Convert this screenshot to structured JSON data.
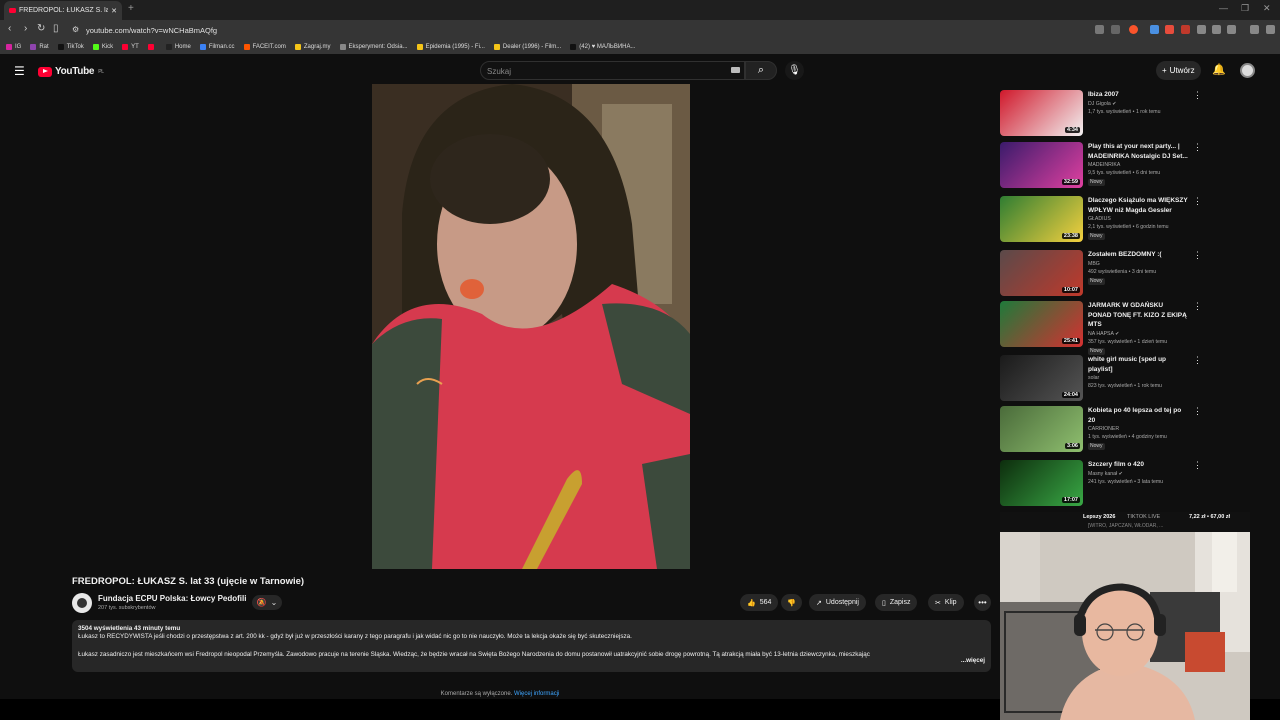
{
  "browser": {
    "tab_title": "FREDROPOL: ŁUKASZ S. lat 3",
    "tab_close": "✕",
    "new_tab": "+",
    "url": "youtube.com/watch?v=wNCHaBmAQfg",
    "bookmarks": [
      {
        "label": "IG",
        "color": "#d6249f"
      },
      {
        "label": "Rat",
        "color": "#8e44ad"
      },
      {
        "label": "TikTok",
        "color": "#111111"
      },
      {
        "label": "Kick",
        "color": "#53fc18"
      },
      {
        "label": "YT",
        "color": "#ff0033"
      },
      {
        "label": "",
        "color": "#ff0033"
      },
      {
        "label": "Home",
        "color": "#222222"
      },
      {
        "label": "Filman.cc",
        "color": "#3b82f6"
      },
      {
        "label": "FACEIT.com",
        "color": "#ff5500"
      },
      {
        "label": "Zagraj.my",
        "color": "#f5c518"
      },
      {
        "label": "Eksperyment: Odsia...",
        "color": "#888888"
      },
      {
        "label": "Epidemia (1995) - Fi...",
        "color": "#f5c518"
      },
      {
        "label": "Dealer (1996) - Film...",
        "color": "#f5c518"
      },
      {
        "label": "(42) ♥ МАЛЬВИНА...",
        "color": "#111111"
      }
    ]
  },
  "youtube": {
    "logo_text": "YouTube",
    "logo_region": "PL",
    "search_placeholder": "Szukaj",
    "create_label": "Utwórz",
    "create_icon": "+"
  },
  "video": {
    "title": "FREDROPOL: ŁUKASZ S. lat 33 (ujęcie w Tarnowie)",
    "channel_name": "Fundacja ECPU Polska: Łowcy Pedofili",
    "channel_subs": "207 tys. subskrybentów",
    "likes": "564",
    "share_label": "Udostępnij",
    "save_label": "Zapisz",
    "clip_label": "Klip",
    "more_label": "•••",
    "stats": "3504 wyświetlenia  43 minuty temu",
    "desc_line1": "Łukasz to RECYDYWISTA jeśli chodzi o przestępstwa z art. 200 kk - gdyż był już w przeszłości karany z tego paragrafu i jak widać nic go to nie nauczyło. Może ta lekcja okaże się być skuteczniejsza.",
    "desc_line2": "Łukasz zasadniczo jest mieszkańcem wsi Fredropol nieopodal Przemyśla. Zawodowo pracuje na terenie Śląska. Wiedząc, że będzie wracał na Święta Bożego Narodzenia do domu postanowił uatrakcyjnić sobie drogę powrotną. Tą atrakcją miała być 13-letnia dziewczynka, mieszkając",
    "desc_more": "...więcej",
    "comments_off": "Komentarze są wyłączone.",
    "comments_link": "Więcej informacji"
  },
  "recommendations": [
    {
      "title": "Ibiza 2007",
      "channel": "DJ Gigola ✔",
      "meta": "1,7 tys. wyświetleń • 1 rok temu",
      "duration": "4:34",
      "new": "",
      "c1": "#d0182b",
      "c2": "#f2f2f2"
    },
    {
      "title": "Play this at your next party... | MADEINRIKA Nostalgic DJ Set...",
      "channel": "MADEINRIKA",
      "meta": "9,5 tys. wyświetleń • 6 dni temu",
      "duration": "32:59",
      "new": "Nowy",
      "c1": "#3a1b6b",
      "c2": "#e040a0"
    },
    {
      "title": "Dlaczego Książulo ma WIĘKSZY WPŁYW niż Magda Gessler",
      "channel": "GŁADIUS",
      "meta": "2,1 tys. wyświetleń • 6 godzin temu",
      "duration": "23:38",
      "new": "Nowy",
      "c1": "#2f7d32",
      "c2": "#f4d03f"
    },
    {
      "title": "Zostałem BEZDOMNY :(",
      "channel": "MBG",
      "meta": "492 wyświetlenia • 3 dni temu",
      "duration": "10:07",
      "new": "Nowy",
      "c1": "#5a4a4a",
      "c2": "#c0392b"
    },
    {
      "title": "JARMARK W GDAŃSKU PONAD TONĘ FT. KIZO Z EKIPĄ MTS",
      "channel": "NA HAPSA ✔",
      "meta": "357 tys. wyświetleń • 1 dzień temu",
      "duration": "25:41",
      "new": "Nowy",
      "c1": "#1e7a3a",
      "c2": "#d63031"
    },
    {
      "title": "white girl music [sped up playlist]",
      "channel": "solar",
      "meta": "823 tys. wyświetleń • 1 rok temu",
      "duration": "24:04",
      "new": "",
      "c1": "#1a1a1a",
      "c2": "#555555"
    },
    {
      "title": "Kobieta po 40 lepsza od tej po 20",
      "channel": "CARRIONER",
      "meta": "1 tys. wyświetleń • 4 godziny temu",
      "duration": "3:06",
      "new": "Nowy",
      "c1": "#4a6b3a",
      "c2": "#8fbf6f"
    },
    {
      "title": "Szczery film o 420",
      "channel": "Masny kanał ✔",
      "meta": "241 tys. wyświetleń • 3 lata temu",
      "duration": "17:07",
      "new": "",
      "c1": "#0d2d0d",
      "c2": "#39a845"
    }
  ],
  "tiktok": {
    "label": "Lepszy 2026",
    "live": "TIKTOK LIVE",
    "money": "7,22 zł • 67,00 zł",
    "sub": "[WITRO, JAPCZAN, WŁODAR, ..."
  },
  "colors": {
    "bg": "#0f0f0f",
    "pill": "#272727",
    "accent": "#ff0033",
    "link": "#3ea6ff"
  }
}
